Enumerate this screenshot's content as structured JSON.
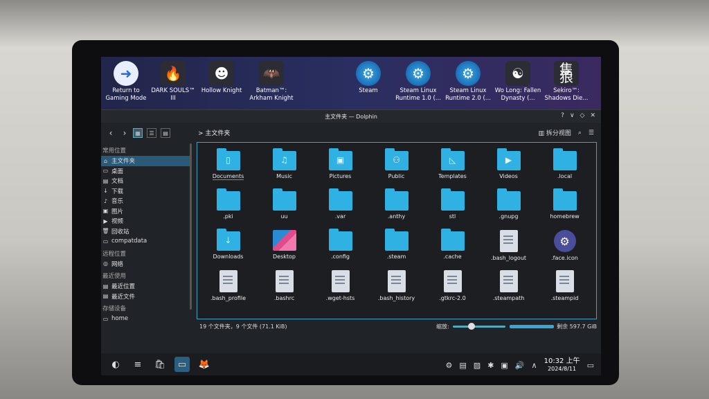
{
  "desktop": {
    "icons": [
      {
        "label": "Return to Gaming Mode",
        "glyph": "➜"
      },
      {
        "label": "DARK SOULS™ III",
        "glyph": "🔥"
      },
      {
        "label": "Hollow Knight",
        "glyph": "☻"
      },
      {
        "label": "Batman™: Arkham Knight",
        "glyph": "🦇"
      },
      {
        "label": "Steam",
        "glyph": "⚙"
      },
      {
        "label": "Steam Linux Runtime 1.0 (...",
        "glyph": "⚙"
      },
      {
        "label": "Steam Linux Runtime 2.0 (...",
        "glyph": "⚙"
      },
      {
        "label": "Wo Long: Fallen Dynasty (...",
        "glyph": "☯"
      },
      {
        "label": "Sekiro™: Shadows Die...",
        "glyph": "隻狼"
      }
    ]
  },
  "window": {
    "title": "主文件夹 — Dolphin",
    "controls": [
      "?",
      "∨",
      "◇",
      "✕"
    ]
  },
  "toolbar": {
    "back": "‹",
    "forward": "›",
    "breadcrumb": "> 主文件夹",
    "split_label": "拆分视图"
  },
  "sidebar": {
    "sections": [
      {
        "title": "常用位置",
        "items": [
          {
            "label": "主文件夹",
            "icon": "⌂",
            "selected": true
          },
          {
            "label": "桌面",
            "icon": "▭"
          },
          {
            "label": "文档",
            "icon": "▤"
          },
          {
            "label": "下载",
            "icon": "↓"
          },
          {
            "label": "音乐",
            "icon": "♪"
          },
          {
            "label": "图片",
            "icon": "▣"
          },
          {
            "label": "视频",
            "icon": "▶"
          },
          {
            "label": "回收站",
            "icon": "🗑"
          },
          {
            "label": "compatdata",
            "icon": "▭"
          }
        ]
      },
      {
        "title": "远程位置",
        "items": [
          {
            "label": "网络",
            "icon": "◎"
          }
        ]
      },
      {
        "title": "最近使用",
        "items": [
          {
            "label": "最近位置",
            "icon": "▤"
          },
          {
            "label": "最近文件",
            "icon": "▤"
          }
        ]
      },
      {
        "title": "存储设备",
        "items": [
          {
            "label": "home",
            "icon": "▭"
          }
        ]
      }
    ]
  },
  "files": [
    {
      "name": "Documents",
      "type": "folder",
      "glyph": "▯",
      "underline": true
    },
    {
      "name": "Music",
      "type": "folder",
      "glyph": "♫"
    },
    {
      "name": "Pictures",
      "type": "folder",
      "glyph": "▣"
    },
    {
      "name": "Public",
      "type": "folder",
      "glyph": "⚇"
    },
    {
      "name": "Templates",
      "type": "folder",
      "glyph": "◺"
    },
    {
      "name": "Videos",
      "type": "folder",
      "glyph": "▶"
    },
    {
      "name": ".local",
      "type": "folder",
      "glyph": ""
    },
    {
      "name": ".pki",
      "type": "folder",
      "glyph": ""
    },
    {
      "name": "uu",
      "type": "folder",
      "glyph": ""
    },
    {
      "name": ".var",
      "type": "folder",
      "glyph": ""
    },
    {
      "name": ".anthy",
      "type": "folder",
      "glyph": ""
    },
    {
      "name": "stl",
      "type": "folder",
      "glyph": ""
    },
    {
      "name": ".gnupg",
      "type": "folder",
      "glyph": ""
    },
    {
      "name": "homebrew",
      "type": "folder",
      "glyph": ""
    },
    {
      "name": "Downloads",
      "type": "folder",
      "glyph": "↓"
    },
    {
      "name": "Desktop",
      "type": "desktop",
      "glyph": ""
    },
    {
      "name": ".config",
      "type": "folder",
      "glyph": ""
    },
    {
      "name": ".steam",
      "type": "folder",
      "glyph": ""
    },
    {
      "name": ".cache",
      "type": "folder",
      "glyph": ""
    },
    {
      "name": ".bash_logout",
      "type": "doc",
      "glyph": ""
    },
    {
      "name": ".face.icon",
      "type": "steam",
      "glyph": "⚙"
    },
    {
      "name": ".bash_profile",
      "type": "doc",
      "glyph": ""
    },
    {
      "name": ".bashrc",
      "type": "doc",
      "glyph": ""
    },
    {
      "name": ".wget-hsts",
      "type": "doc",
      "glyph": ""
    },
    {
      "name": ".bash_history",
      "type": "doc",
      "glyph": ""
    },
    {
      "name": ".gtkrc-2.0",
      "type": "doc",
      "glyph": ""
    },
    {
      "name": ".steampath",
      "type": "doc",
      "glyph": ""
    },
    {
      "name": ".steampid",
      "type": "doc",
      "glyph": ""
    }
  ],
  "status": {
    "summary": "19 个文件夹，9 个文件 (71.1 KiB)",
    "zoom_label": "缩放:",
    "free_label": "剩余 597.7 GiB"
  },
  "taskbar": {
    "icons": [
      "◐",
      "≡",
      "🛍",
      "▭",
      "🦊"
    ],
    "tray": [
      "⚙",
      "▤",
      "▨",
      "✱",
      "▣",
      "🔊",
      "∧"
    ],
    "time": "10:32 上午",
    "date": "2024/8/11"
  },
  "colors": {
    "accent": "#3fa0c8",
    "folder": "#2fb1e3",
    "selection": "#2b5a78"
  }
}
